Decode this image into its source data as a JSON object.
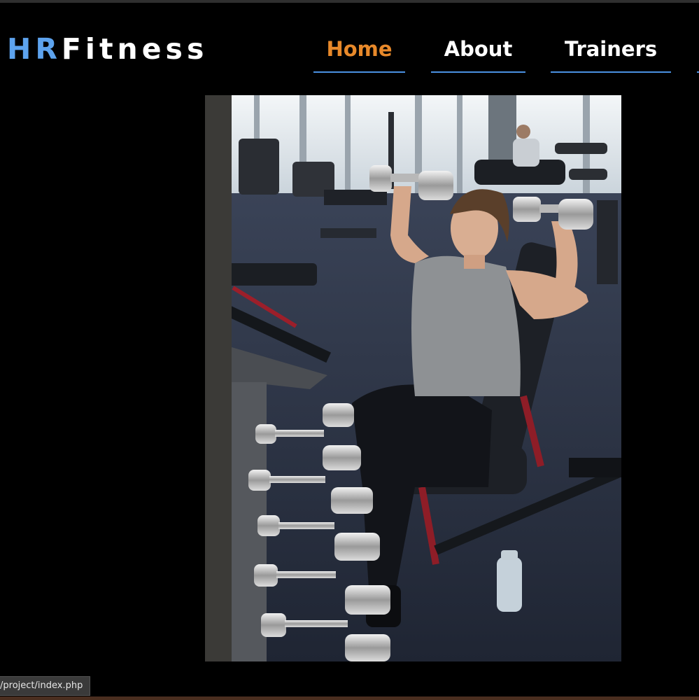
{
  "brand": {
    "part1": "HR",
    "part2": "Fitness"
  },
  "nav": {
    "items": [
      {
        "label": "Home",
        "active": true
      },
      {
        "label": "About",
        "active": false
      },
      {
        "label": "Trainers",
        "active": false
      }
    ]
  },
  "hero": {
    "alt": "Man doing dumbbell shoulder press on a bench in a gym"
  },
  "status_bar": {
    "url": "/project/index.php"
  },
  "colors": {
    "background": "#000000",
    "brand_accent": "#5da3ee",
    "nav_active": "#e8892a",
    "nav_underline": "#4a90e2",
    "nav_text": "#ffffff"
  }
}
